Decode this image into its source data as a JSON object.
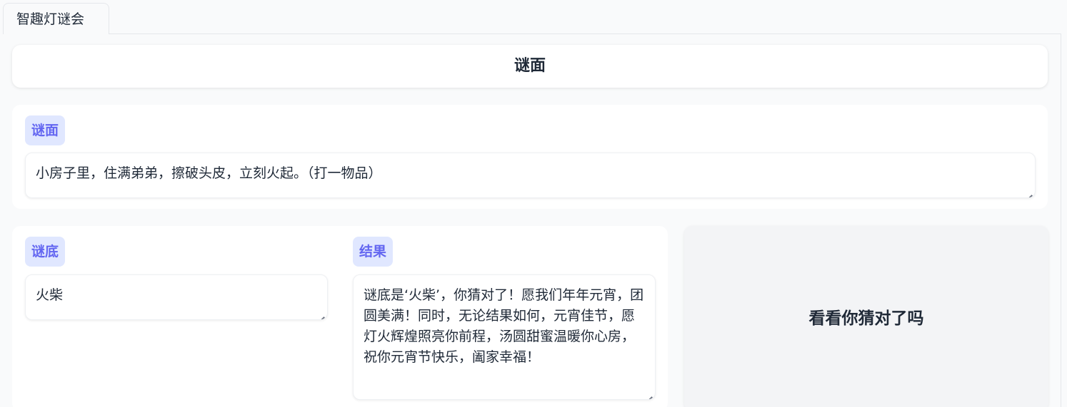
{
  "tab": {
    "label": "智趣灯谜会"
  },
  "header": {
    "title": "谜面"
  },
  "riddle": {
    "label": "谜面",
    "value": "小房子里，住满弟弟，擦破头皮，立刻火起。（打一物品）"
  },
  "answer": {
    "label": "谜底",
    "value": "火柴"
  },
  "result": {
    "label": "结果",
    "value": "谜底是‘火柴’，你猜对了！愿我们年年元宵，团圆美满！同时，无论结果如何，元宵佳节，愿灯火辉煌照亮你前程，汤圆甜蜜温暖你心房， 祝你元宵节快乐，阖家幸福！"
  },
  "check": {
    "title": "看看你猜对了吗"
  },
  "colors": {
    "accent": "#6366f1",
    "label_bg": "#e0e7ff",
    "panel_bg": "#f3f4f6"
  }
}
